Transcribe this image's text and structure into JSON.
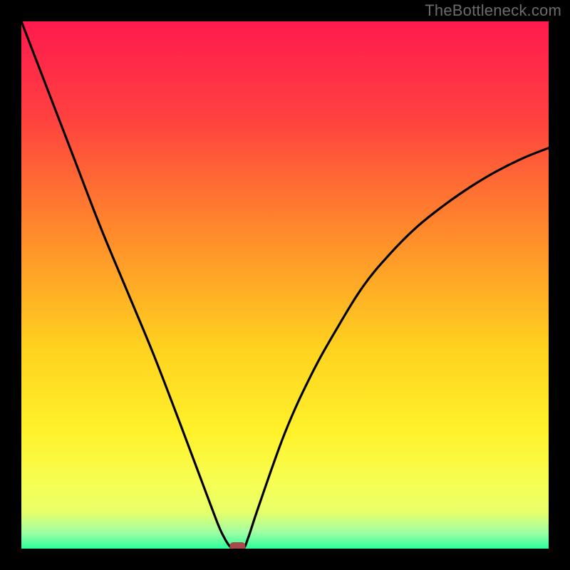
{
  "watermark": "TheBottleneck.com",
  "chart_data": {
    "type": "line",
    "title": "",
    "xlabel": "",
    "ylabel": "",
    "xlim": [
      0,
      100
    ],
    "ylim": [
      0,
      100
    ],
    "x": [
      0,
      5,
      10,
      15,
      20,
      25,
      30,
      33,
      36,
      38,
      40,
      42,
      43,
      45,
      50,
      55,
      60,
      65,
      70,
      75,
      80,
      85,
      90,
      95,
      100
    ],
    "y": [
      100,
      87,
      74,
      61,
      49,
      37,
      24,
      16,
      8,
      3,
      0,
      0,
      2,
      8,
      22,
      33,
      42,
      50,
      56,
      61,
      65,
      68.5,
      71.5,
      74,
      76
    ],
    "annotations": [
      {
        "x": 41,
        "y": 0,
        "label": "marker",
        "color": "#a84a4a"
      }
    ],
    "background_gradient": {
      "top": "#ff1a4e",
      "upper_mid": "#ff8a2b",
      "mid": "#fff22b",
      "lower_mid": "#e8ff6a",
      "bottom": "#2bff9a"
    }
  }
}
